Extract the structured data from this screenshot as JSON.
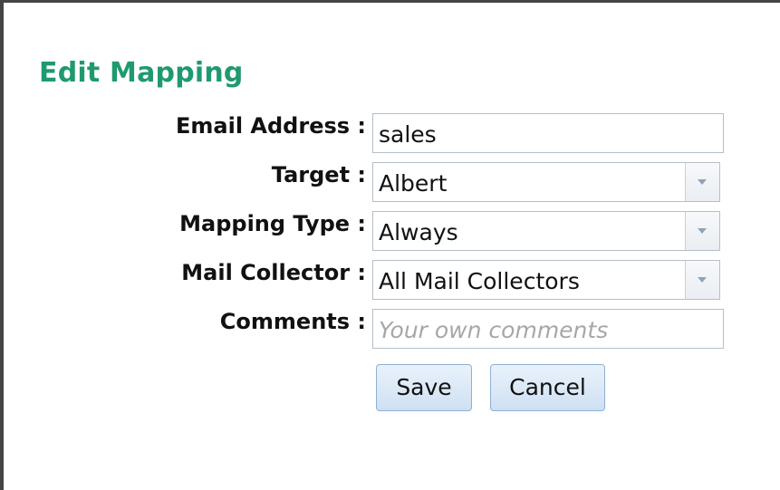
{
  "dialog": {
    "title": "Edit Mapping"
  },
  "form": {
    "email": {
      "label": "Email Address :",
      "value": "sales"
    },
    "target": {
      "label": "Target :",
      "value": "Albert"
    },
    "mapping_type": {
      "label": "Mapping Type :",
      "value": "Always"
    },
    "mail_collector": {
      "label": "Mail Collector :",
      "value": "All Mail Collectors"
    },
    "comments": {
      "label": "Comments :",
      "value": "",
      "placeholder": "Your own comments"
    }
  },
  "buttons": {
    "save_label": "Save",
    "cancel_label": "Cancel"
  },
  "icons": {
    "dropdown": "chevron-down-icon"
  },
  "colors": {
    "title": "#1f9a6e",
    "field_border": "#b5bfc8",
    "button_border": "#8fb0d2",
    "button_fill": "#dbe8f6",
    "frame": "#444444"
  }
}
